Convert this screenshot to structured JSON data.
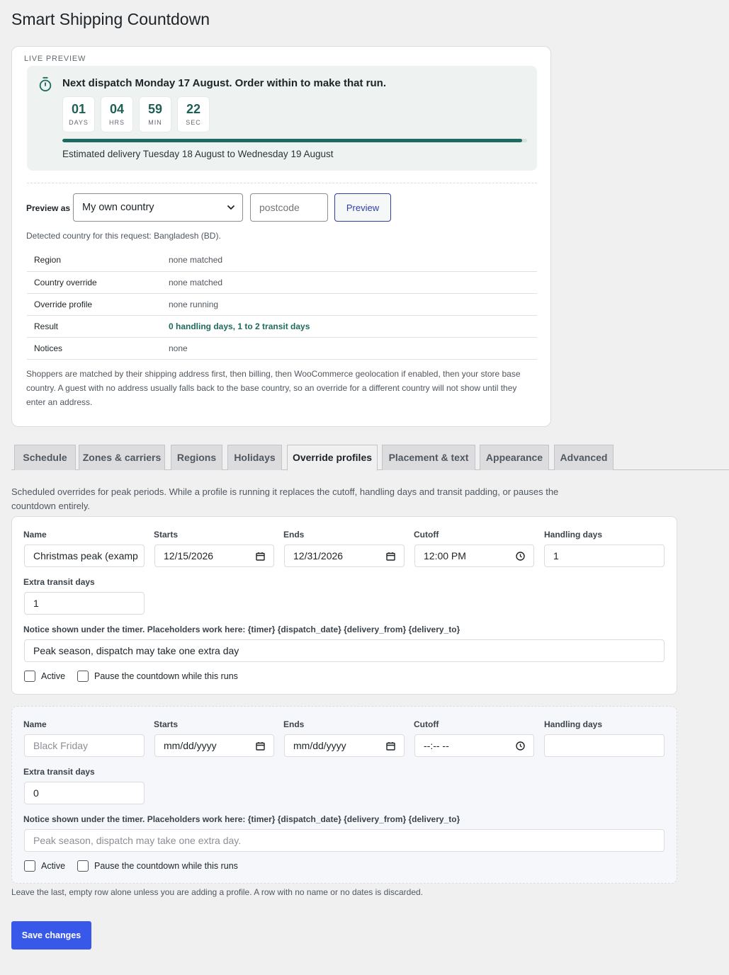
{
  "page": {
    "title": "Smart Shipping Countdown"
  },
  "preview": {
    "label": "LIVE PREVIEW",
    "headline": "Next dispatch Monday 17 August. Order within to make that run.",
    "units": [
      {
        "value": "01",
        "label": "DAYS"
      },
      {
        "value": "04",
        "label": "HRS"
      },
      {
        "value": "59",
        "label": "MIN"
      },
      {
        "value": "22",
        "label": "SEC"
      }
    ],
    "progress": 0.99,
    "delivery": "Estimated delivery Tuesday 18 August to Wednesday 19 August",
    "accent": "#1f6a5f",
    "preview_as_label": "Preview as",
    "country_select": "My own country",
    "postcode_placeholder": "postcode",
    "preview_button": "Preview",
    "detected": "Detected country for this request: Bangladesh (BD).",
    "rows": [
      {
        "key": "Region",
        "value": "none matched"
      },
      {
        "key": "Country override",
        "value": "none matched"
      },
      {
        "key": "Override profile",
        "value": "none running"
      },
      {
        "key": "Result",
        "value": "0 handling days, 1 to 2 transit days"
      },
      {
        "key": "Notices",
        "value": "none"
      }
    ],
    "matching_note": "Shoppers are matched by their shipping address first, then billing, then WooCommerce geolocation if enabled, then your store base country. A guest with no address usually falls back to the base country, so an override for a different country will not show until they enter an address."
  },
  "tabs": [
    {
      "label": "Schedule"
    },
    {
      "label": "Zones & carriers"
    },
    {
      "label": "Regions"
    },
    {
      "label": "Holidays"
    },
    {
      "label": "Override profiles",
      "active": true
    },
    {
      "label": "Placement & text"
    },
    {
      "label": "Appearance"
    },
    {
      "label": "Advanced"
    }
  ],
  "overrides": {
    "intro": "Scheduled overrides for peak periods. While a profile is running it replaces the cutoff, handling days and transit padding, or pauses the countdown entirely.",
    "labels": {
      "name": "Name",
      "starts": "Starts",
      "ends": "Ends",
      "cutoff": "Cutoff",
      "handling": "Handling days",
      "transit": "Extra transit days",
      "notice": "Notice shown under the timer. Placeholders work here: {timer} {dispatch_date} {delivery_from} {delivery_to}",
      "active": "Active",
      "pause": "Pause the countdown while this runs"
    },
    "profiles": [
      {
        "name": "Christmas peak (examp",
        "starts": "12/15/2026",
        "ends": "12/31/2026",
        "cutoff": "12:00 PM",
        "handling": "1",
        "transit": "1",
        "notice": "Peak season, dispatch may take one extra day"
      },
      {
        "name_placeholder": "Black Friday",
        "starts": "mm/dd/yyyy",
        "ends": "mm/dd/yyyy",
        "cutoff": "--:-- --",
        "handling": "",
        "transit": "0",
        "notice_placeholder": "Peak season, dispatch may take one extra day."
      }
    ],
    "footer_note": "Leave the last, empty row alone unless you are adding a profile. A row with no name or no dates is discarded.",
    "save_button": "Save changes"
  }
}
